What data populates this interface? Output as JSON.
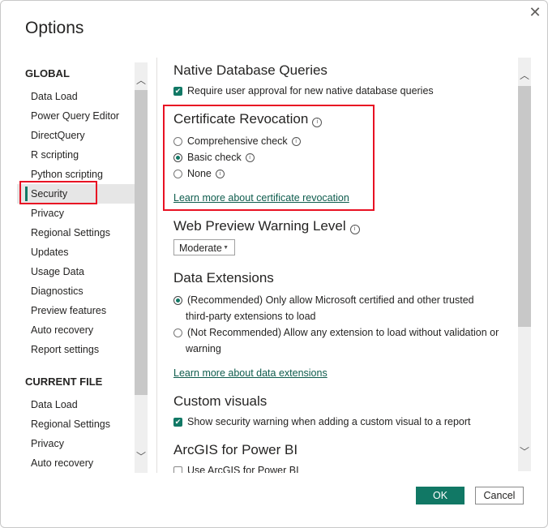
{
  "dialog": {
    "title": "Options",
    "close_icon": "close-icon"
  },
  "sidebar": {
    "global_heading": "GLOBAL",
    "global_items": [
      {
        "label": "Data Load"
      },
      {
        "label": "Power Query Editor"
      },
      {
        "label": "DirectQuery"
      },
      {
        "label": "R scripting"
      },
      {
        "label": "Python scripting"
      },
      {
        "label": "Security",
        "selected": true
      },
      {
        "label": "Privacy"
      },
      {
        "label": "Regional Settings"
      },
      {
        "label": "Updates"
      },
      {
        "label": "Usage Data"
      },
      {
        "label": "Diagnostics"
      },
      {
        "label": "Preview features"
      },
      {
        "label": "Auto recovery"
      },
      {
        "label": "Report settings"
      }
    ],
    "current_heading": "CURRENT FILE",
    "current_items": [
      {
        "label": "Data Load"
      },
      {
        "label": "Regional Settings"
      },
      {
        "label": "Privacy"
      },
      {
        "label": "Auto recovery"
      }
    ]
  },
  "content": {
    "native_db": {
      "heading": "Native Database Queries",
      "checkbox_label": "Require user approval for new native database queries",
      "checked": true
    },
    "cert": {
      "heading": "Certificate Revocation",
      "options": [
        {
          "label": "Comprehensive check",
          "selected": false
        },
        {
          "label": "Basic check",
          "selected": true
        },
        {
          "label": "None",
          "selected": false
        }
      ],
      "link": "Learn more about certificate revocation"
    },
    "web_preview": {
      "heading": "Web Preview Warning Level",
      "selected": "Moderate"
    },
    "data_ext": {
      "heading": "Data Extensions",
      "opt1_line1": "(Recommended) Only allow Microsoft certified and other trusted",
      "opt1_line2": "third-party extensions to load",
      "opt2_line1": "(Not Recommended) Allow any extension to load without validation or",
      "opt2_line2": "warning",
      "selected_index": 0,
      "link": "Learn more about data extensions"
    },
    "custom_visuals": {
      "heading": "Custom visuals",
      "checkbox_label": "Show security warning when adding a custom visual to a report",
      "checked": true
    },
    "arcgis": {
      "heading": "ArcGIS for Power BI",
      "checkbox_label": "Use ArcGIS for Power BI",
      "checked": false
    }
  },
  "footer": {
    "ok_label": "OK",
    "cancel_label": "Cancel"
  },
  "colors": {
    "accent": "#117865",
    "highlight": "#e81123"
  }
}
